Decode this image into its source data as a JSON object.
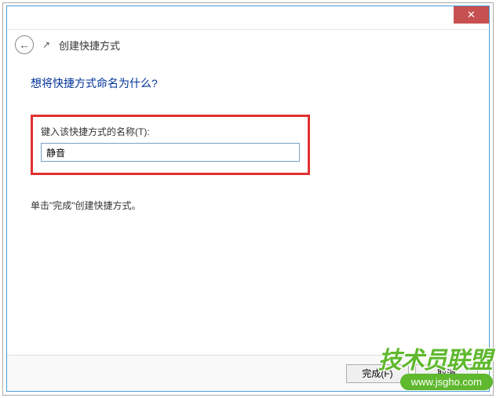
{
  "titlebar": {
    "close_label": "✕"
  },
  "header": {
    "back_arrow": "←",
    "icon_char": "↗",
    "title": "创建快捷方式"
  },
  "content": {
    "heading": "想将快捷方式命名为什么?",
    "input_label": "键入该快捷方式的名称(T):",
    "input_value": "静音",
    "instruction": "单击\"完成\"创建快捷方式。"
  },
  "buttons": {
    "finish": "完成(F)",
    "cancel": "取消"
  },
  "watermark": {
    "text": "技术员联盟",
    "url": "www.jsgho.com"
  }
}
